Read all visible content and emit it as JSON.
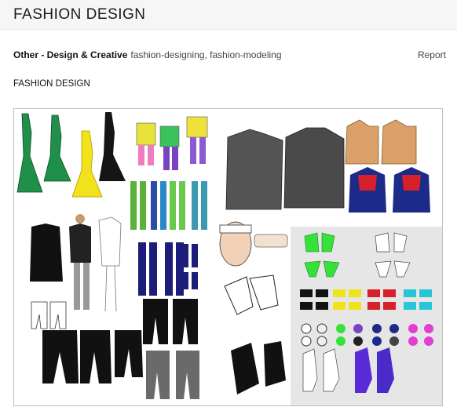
{
  "header": {
    "title": "FASHION DESIGN"
  },
  "meta": {
    "category": "Other - Design & Creative",
    "tags": "fashion-designing, fashion-modeling",
    "report_label": "Report"
  },
  "content": {
    "subtitle": "FASHION DESIGN"
  },
  "colors": {
    "dress_green": "#1f8f4a",
    "dress_yellow": "#f2e21a",
    "jacket_gray": "#555555",
    "navy": "#1c2a8a",
    "red": "#d8202a",
    "bikini_green": "#36e23a",
    "panel_gray": "#e6e6e6"
  }
}
